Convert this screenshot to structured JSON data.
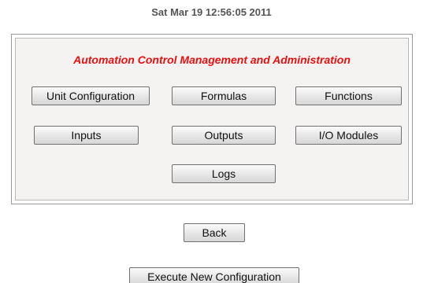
{
  "timestamp": "Sat Mar 19 12:56:05 2011",
  "panel": {
    "title": "Automation Control Management and Administration",
    "buttons": {
      "unit_configuration": "Unit Configuration",
      "formulas": "Formulas",
      "functions": "Functions",
      "inputs": "Inputs",
      "outputs": "Outputs",
      "io_modules": "I/O Modules",
      "logs": "Logs"
    }
  },
  "actions": {
    "back": "Back",
    "execute": "Execute New Configuration"
  },
  "colors": {
    "title": "#e8100e",
    "panel_background": "#f5f2f2",
    "timestamp": "#555555"
  }
}
